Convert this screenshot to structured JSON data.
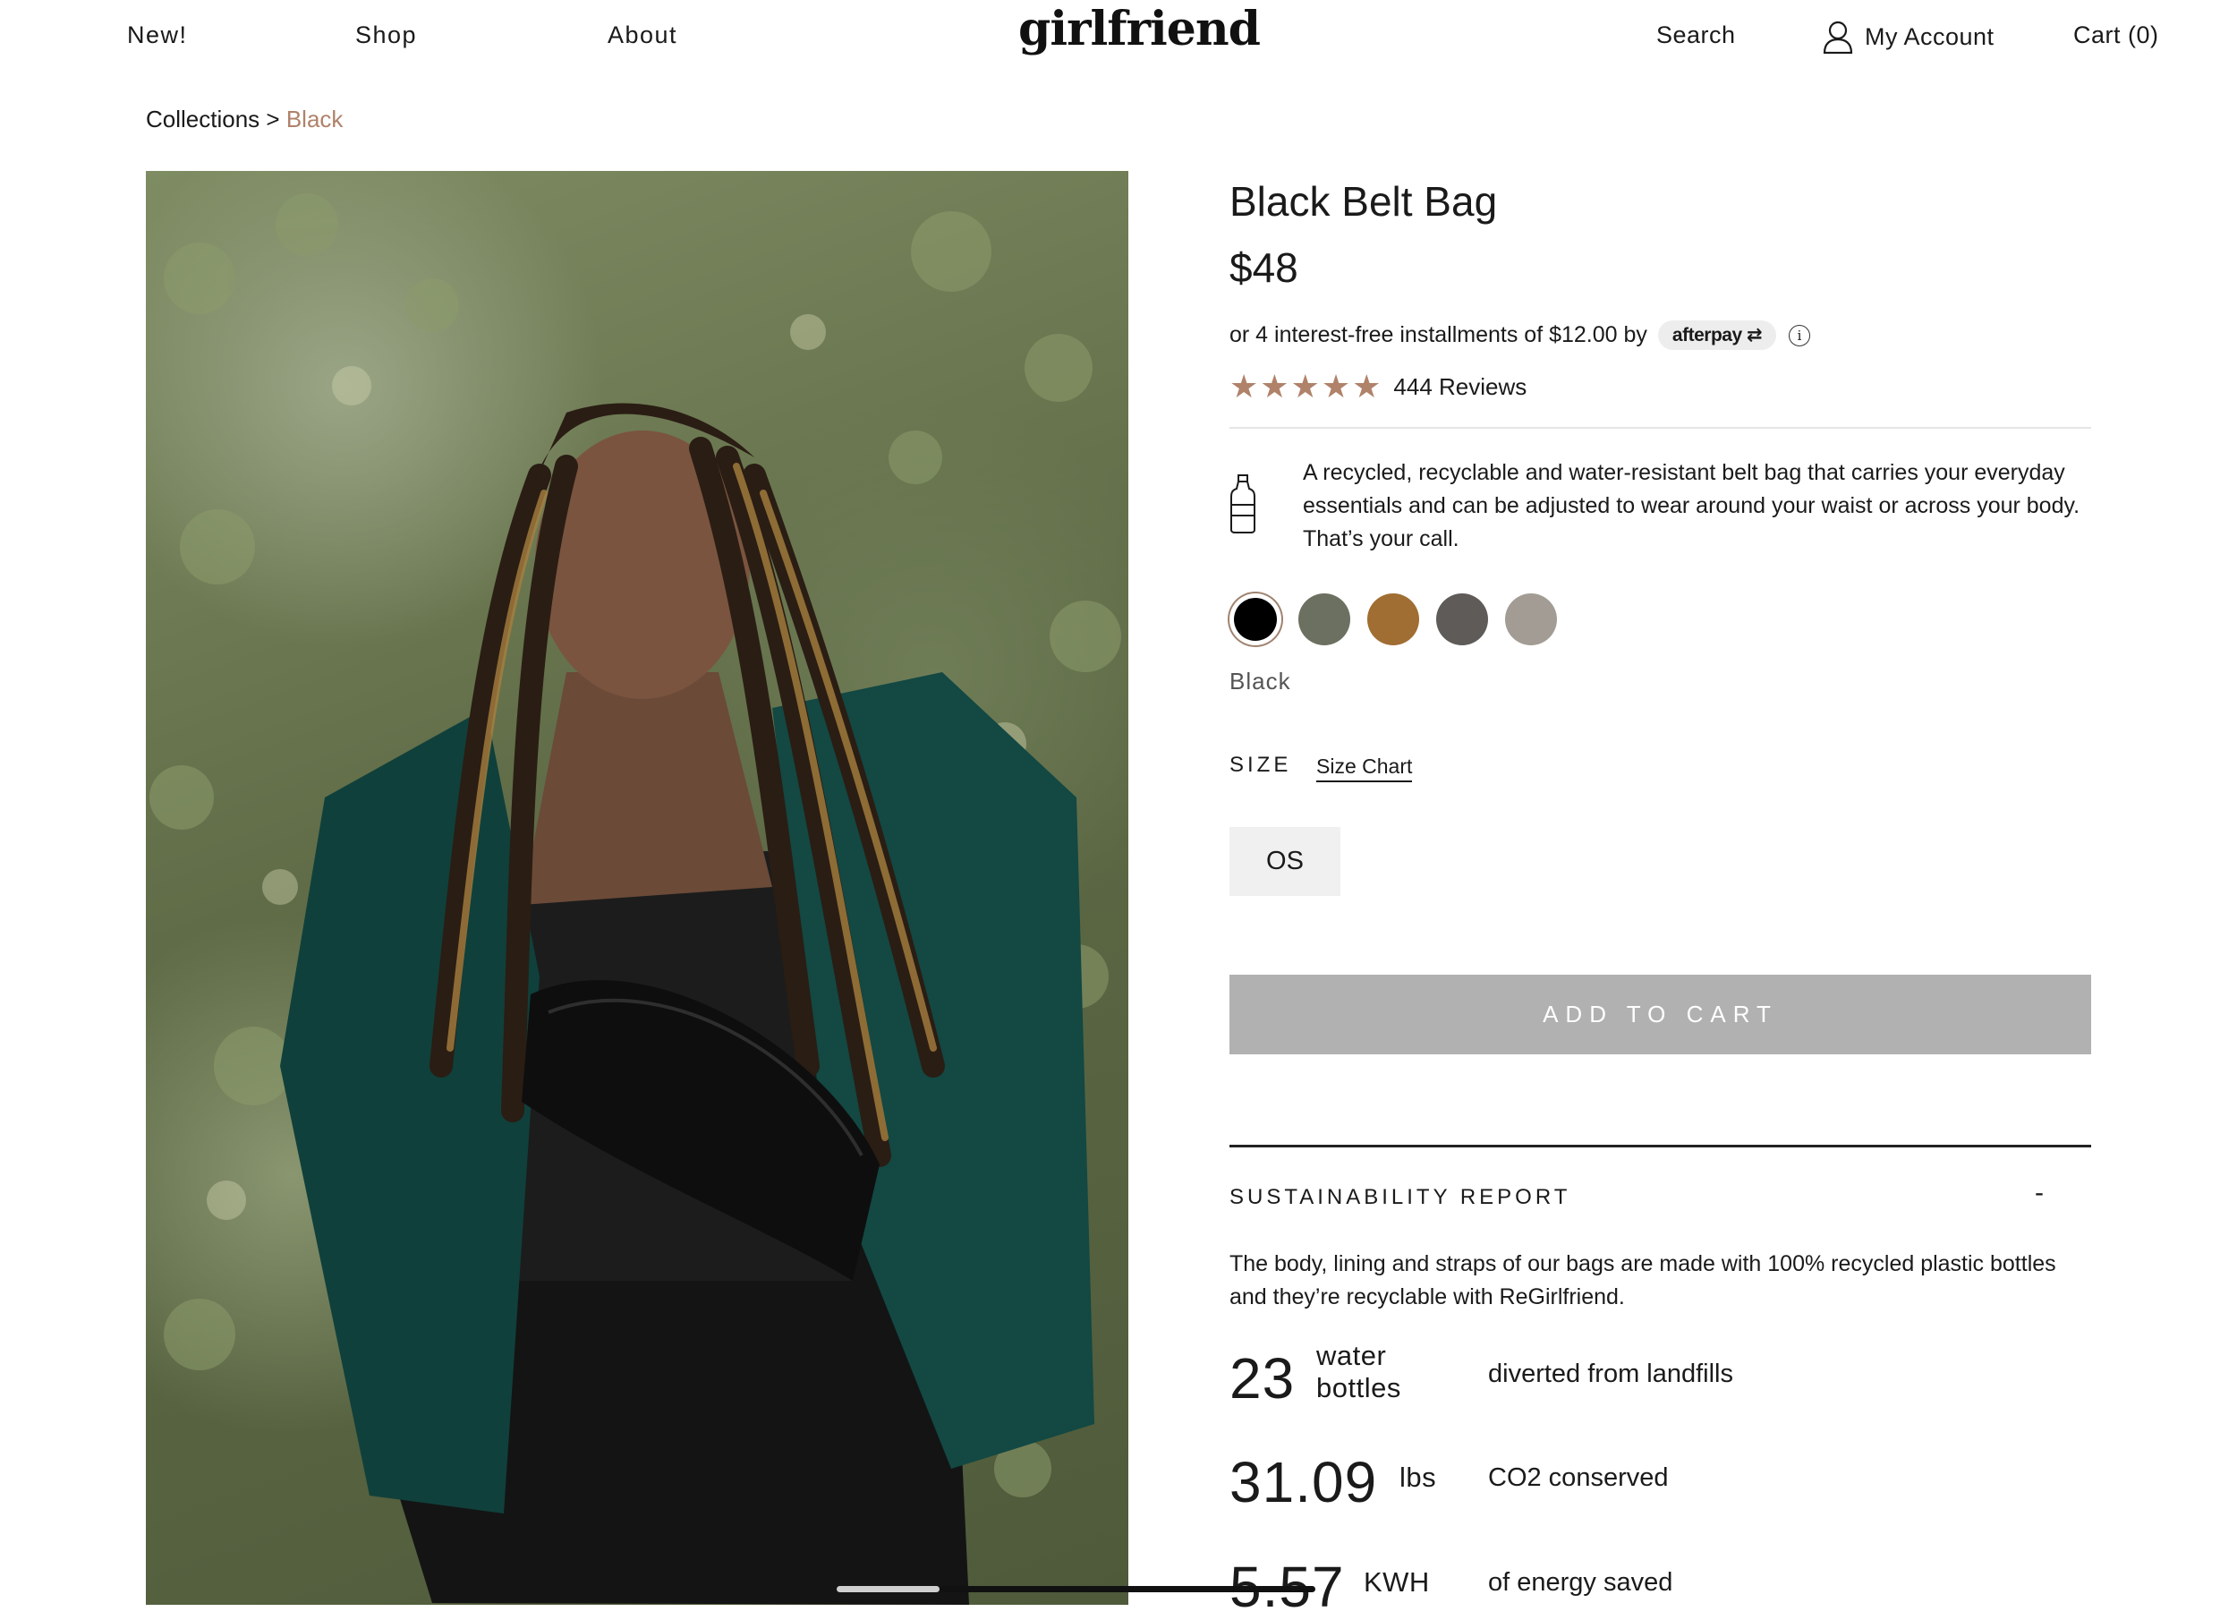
{
  "header": {
    "nav": [
      "New!",
      "Shop",
      "About"
    ],
    "logo": "girlfriend",
    "search": "Search",
    "account": "My Account",
    "cart": "Cart (0)"
  },
  "breadcrumb": {
    "parent": "Collections",
    "separator": ">",
    "current": "Black"
  },
  "product": {
    "title": "Black Belt Bag",
    "price": "$48",
    "installments": "or 4 interest-free installments of $12.00 by",
    "afterpay": "afterpay",
    "info_icon": "i",
    "rating": 5,
    "reviews": "444 Reviews",
    "description": "A recycled, recyclable and water-resistant belt bag that carries your everyday essentials and can be adjusted to wear around your waist or across your body. That’s your call.",
    "colors": [
      {
        "hex": "#000000",
        "selected": true
      },
      {
        "hex": "#6c7060",
        "selected": false
      },
      {
        "hex": "#a06d32",
        "selected": false
      },
      {
        "hex": "#5e5b58",
        "selected": false
      },
      {
        "hex": "#a29c94",
        "selected": false
      }
    ],
    "selected_color_label": "Black",
    "size_heading": "SIZE",
    "size_chart": "Size Chart",
    "sizes": [
      "OS"
    ],
    "add_to_cart": "ADD TO CART"
  },
  "sustainability": {
    "heading": "SUSTAINABILITY REPORT",
    "toggle": "-",
    "text": "The body, lining and straps of our bags are made with 100% recycled plastic bottles and they’re recyclable with ReGirlfriend.",
    "stats": [
      {
        "value": "23",
        "unit": "water bottles",
        "label": "diverted from landfills"
      },
      {
        "value": "31.09",
        "unit": "lbs",
        "label": "CO2 conserved"
      },
      {
        "value": "5.57",
        "unit": "KWH",
        "label": "of energy saved"
      }
    ]
  },
  "colors": {
    "accent": "#b0826a",
    "button_disabled": "#b1b1b1"
  }
}
